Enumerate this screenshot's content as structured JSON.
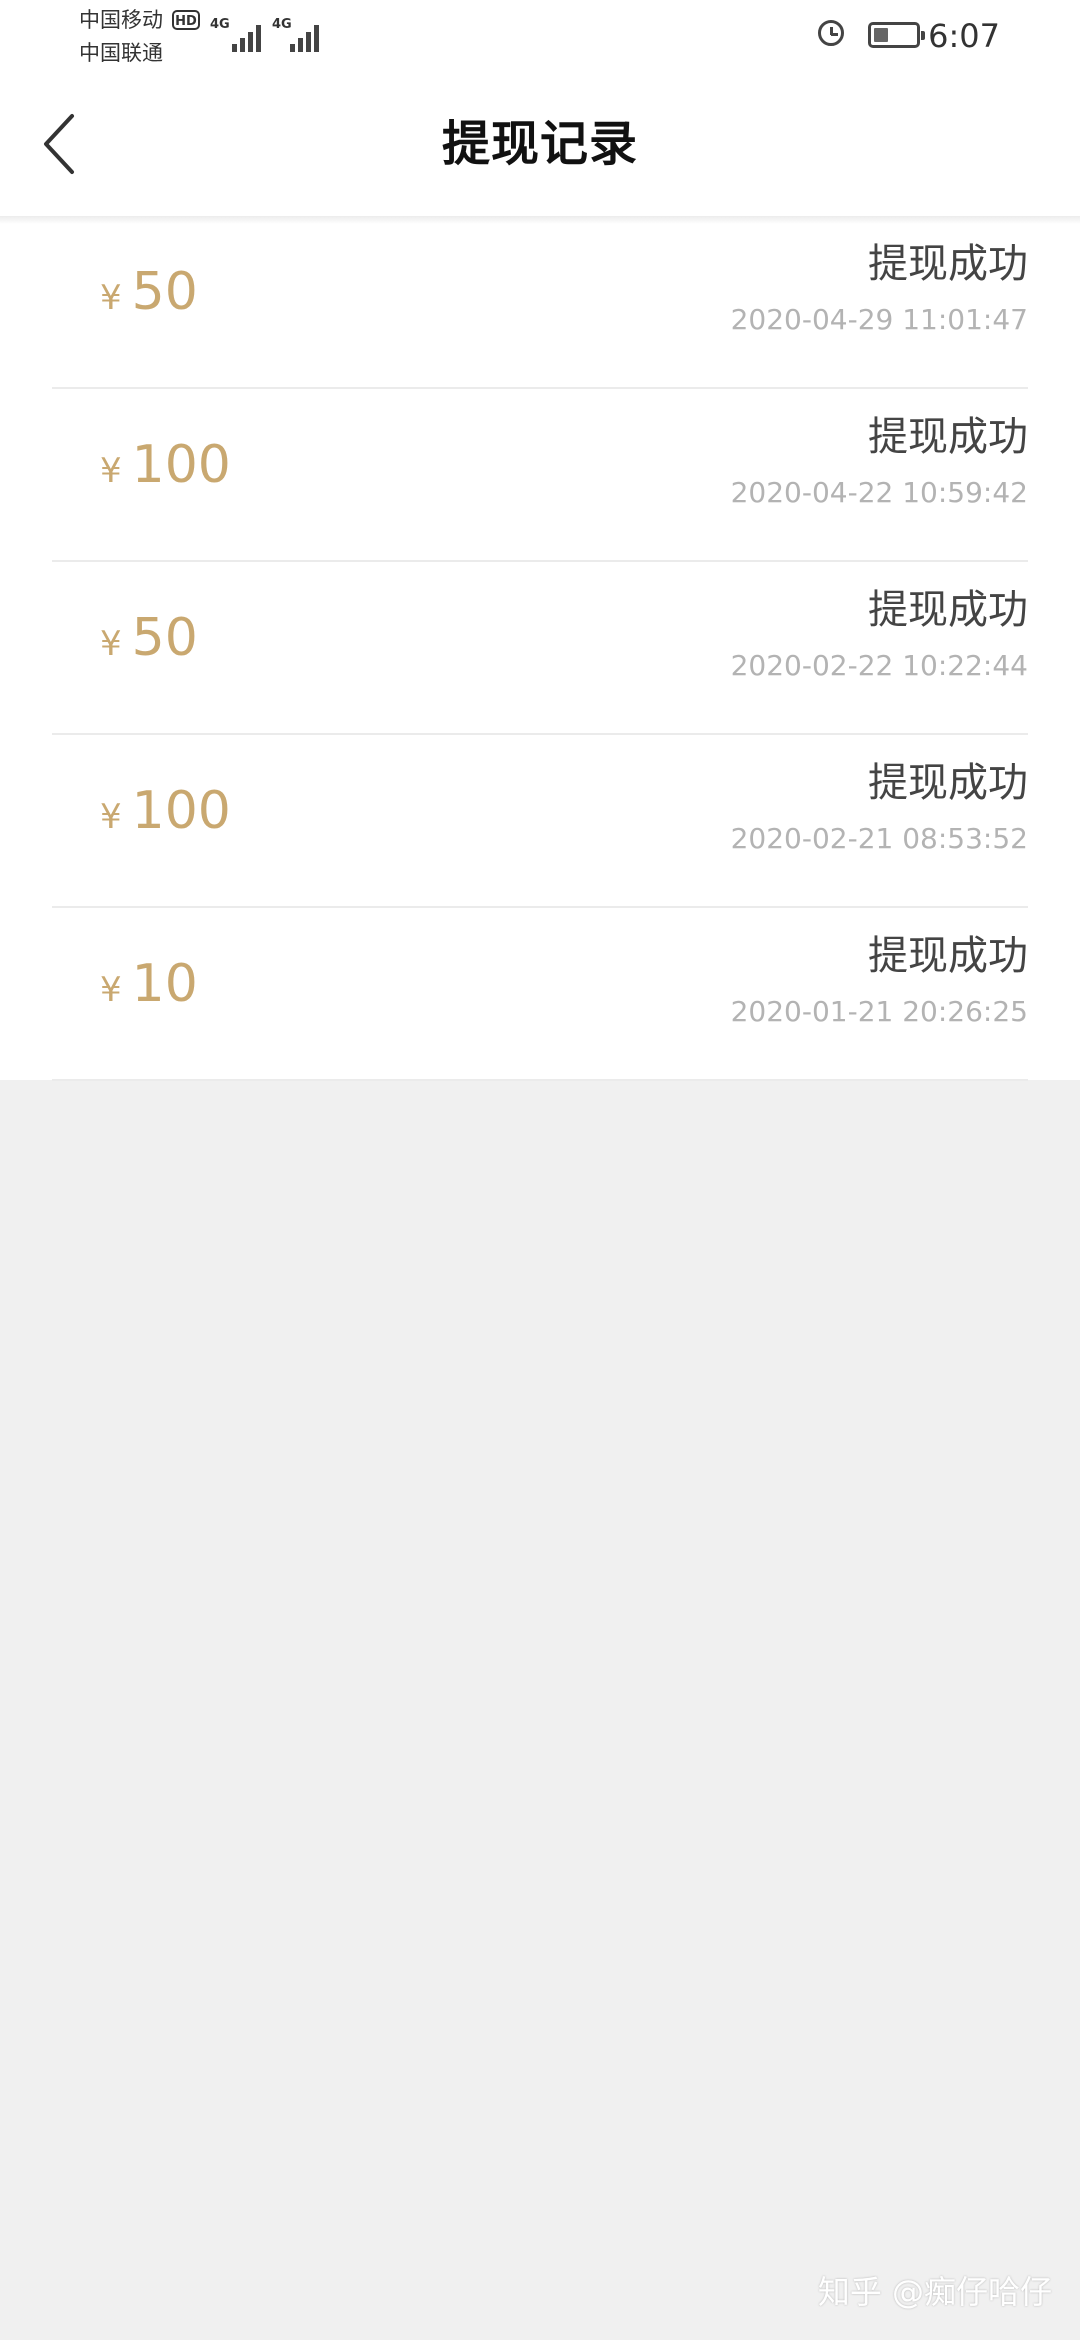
{
  "status_bar": {
    "carrier1": "中国移动",
    "carrier2": "中国联通",
    "hd_badge": "HD",
    "network1": "4G",
    "network2": "4G",
    "battery_level": 0.35,
    "time": "6:07"
  },
  "header": {
    "title": "提现记录"
  },
  "records": [
    {
      "currency": "¥",
      "amount": "50",
      "status": "提现成功",
      "datetime": "2020-04-29 11:01:47"
    },
    {
      "currency": "¥",
      "amount": "100",
      "status": "提现成功",
      "datetime": "2020-04-22 10:59:42"
    },
    {
      "currency": "¥",
      "amount": "50",
      "status": "提现成功",
      "datetime": "2020-02-22 10:22:44"
    },
    {
      "currency": "¥",
      "amount": "100",
      "status": "提现成功",
      "datetime": "2020-02-21 08:53:52"
    },
    {
      "currency": "¥",
      "amount": "10",
      "status": "提现成功",
      "datetime": "2020-01-21 20:26:25"
    }
  ],
  "colors": {
    "amount": "#c9a870",
    "status_text": "#444444",
    "datetime": "#b3b3b3",
    "page_background": "#f0f0f0"
  },
  "watermark": "知乎 @痴仔哈仔"
}
